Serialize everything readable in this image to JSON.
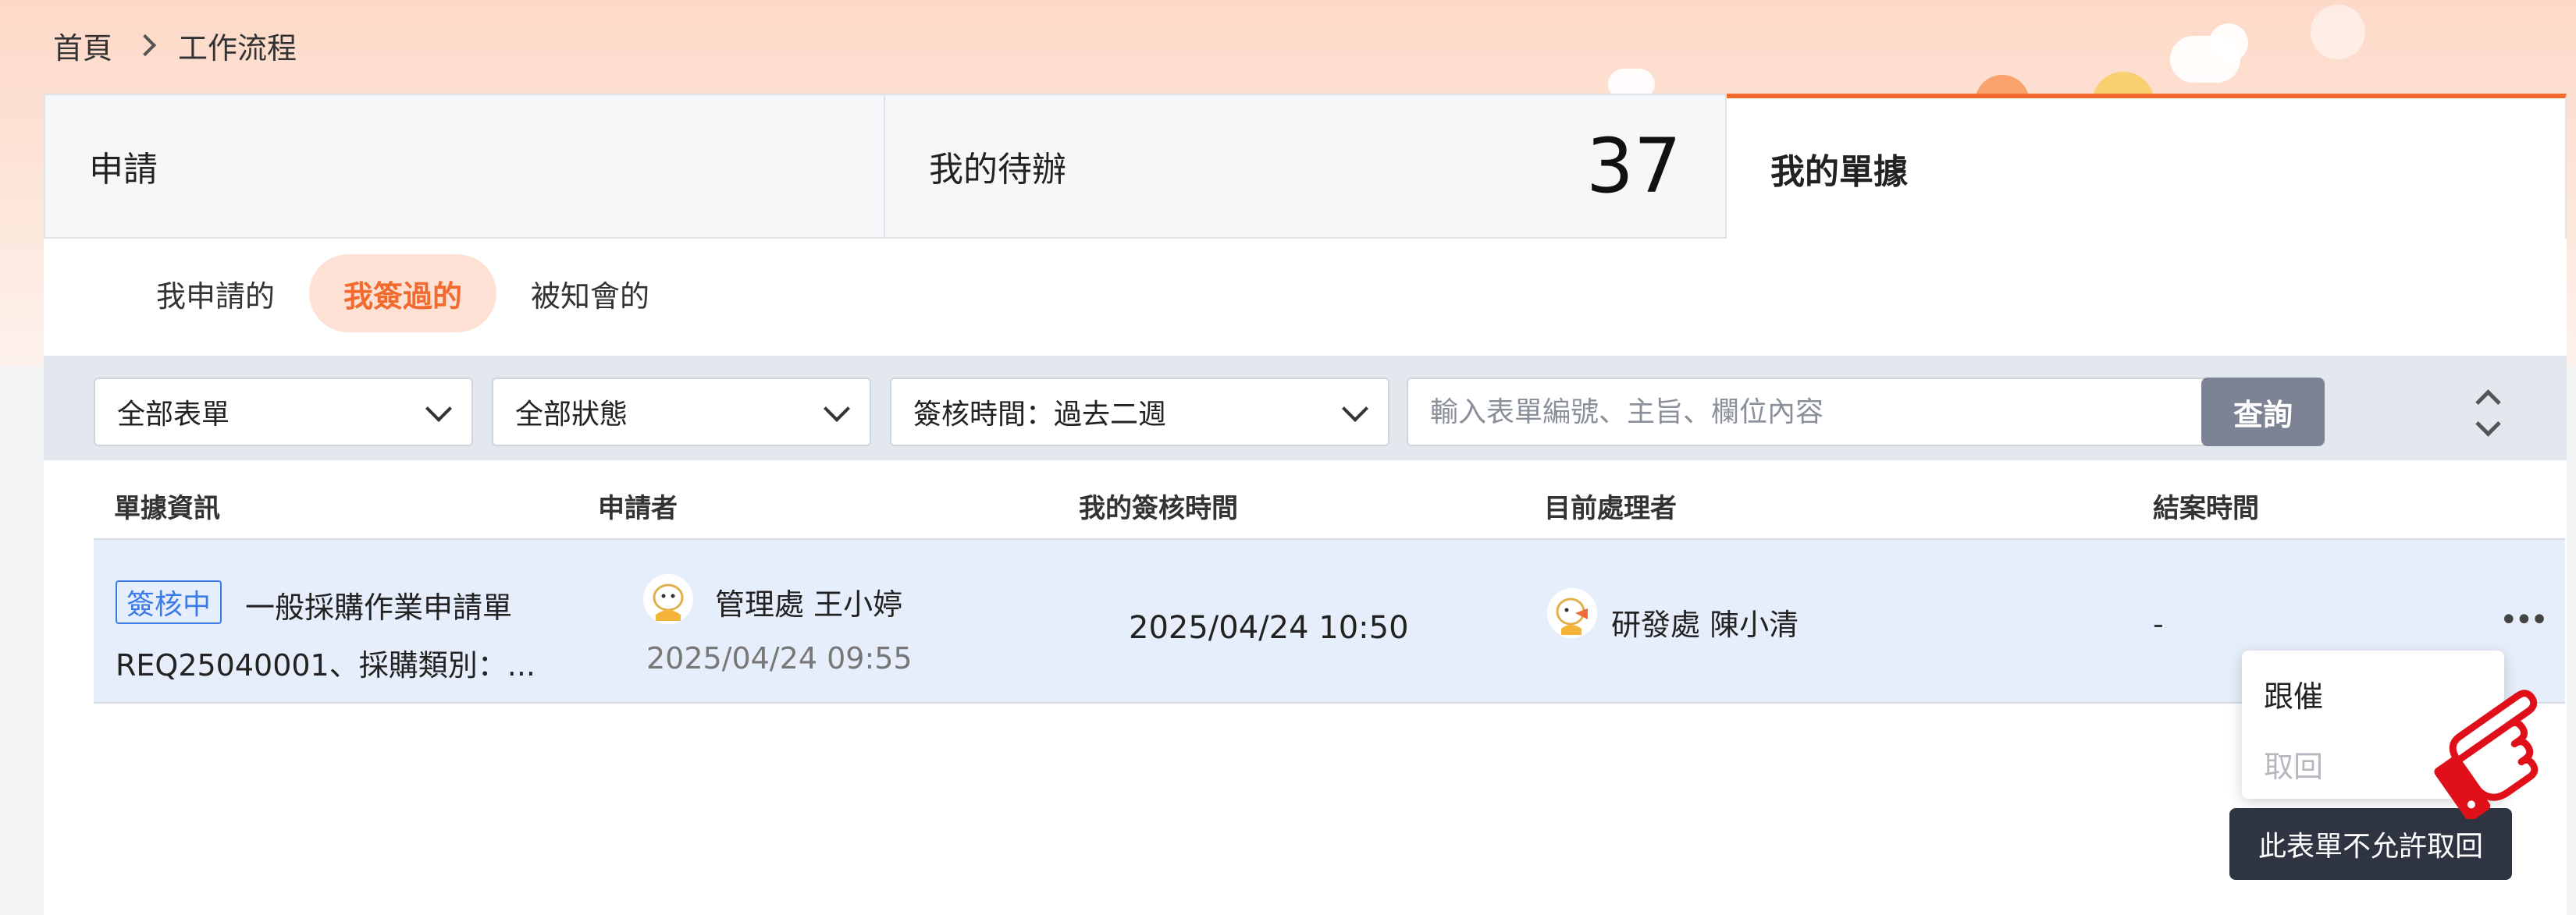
{
  "breadcrumb": {
    "home": "首頁",
    "current": "工作流程"
  },
  "tabs": [
    {
      "label": "申請"
    },
    {
      "label": "我的待辦",
      "count": "37"
    },
    {
      "label": "我的單據",
      "active": true
    }
  ],
  "subtabs": [
    {
      "label": "我申請的"
    },
    {
      "label": "我簽過的",
      "active": true
    },
    {
      "label": "被知會的"
    }
  ],
  "filters": {
    "form_type": "全部表單",
    "status": "全部狀態",
    "sign_time": "簽核時間：過去二週",
    "search_placeholder": "輸入表單編號、主旨、欄位內容",
    "query_label": "查詢"
  },
  "table": {
    "headers": [
      "單據資訊",
      "申請者",
      "我的簽核時間",
      "目前處理者",
      "結案時間"
    ],
    "rows": [
      {
        "status_badge": "簽核中",
        "form_name": "一般採購作業申請單",
        "form_detail": "REQ25040001、採購類別：...",
        "applicant": "管理處 王小婷",
        "applied_time": "2025/04/24 09:55",
        "my_sign_time": "2025/04/24 10:50",
        "current_handler": "研發處 陳小清",
        "close_time": "-",
        "more": "•••"
      }
    ]
  },
  "context_menu": {
    "items": [
      {
        "label": "跟催",
        "enabled": true
      },
      {
        "label": "取回",
        "enabled": false
      }
    ],
    "tooltip": "此表單不允許取回"
  },
  "colors": {
    "accent": "#f26a2e",
    "badge": "#3b7be8",
    "row_bg": "#e7eefb"
  }
}
